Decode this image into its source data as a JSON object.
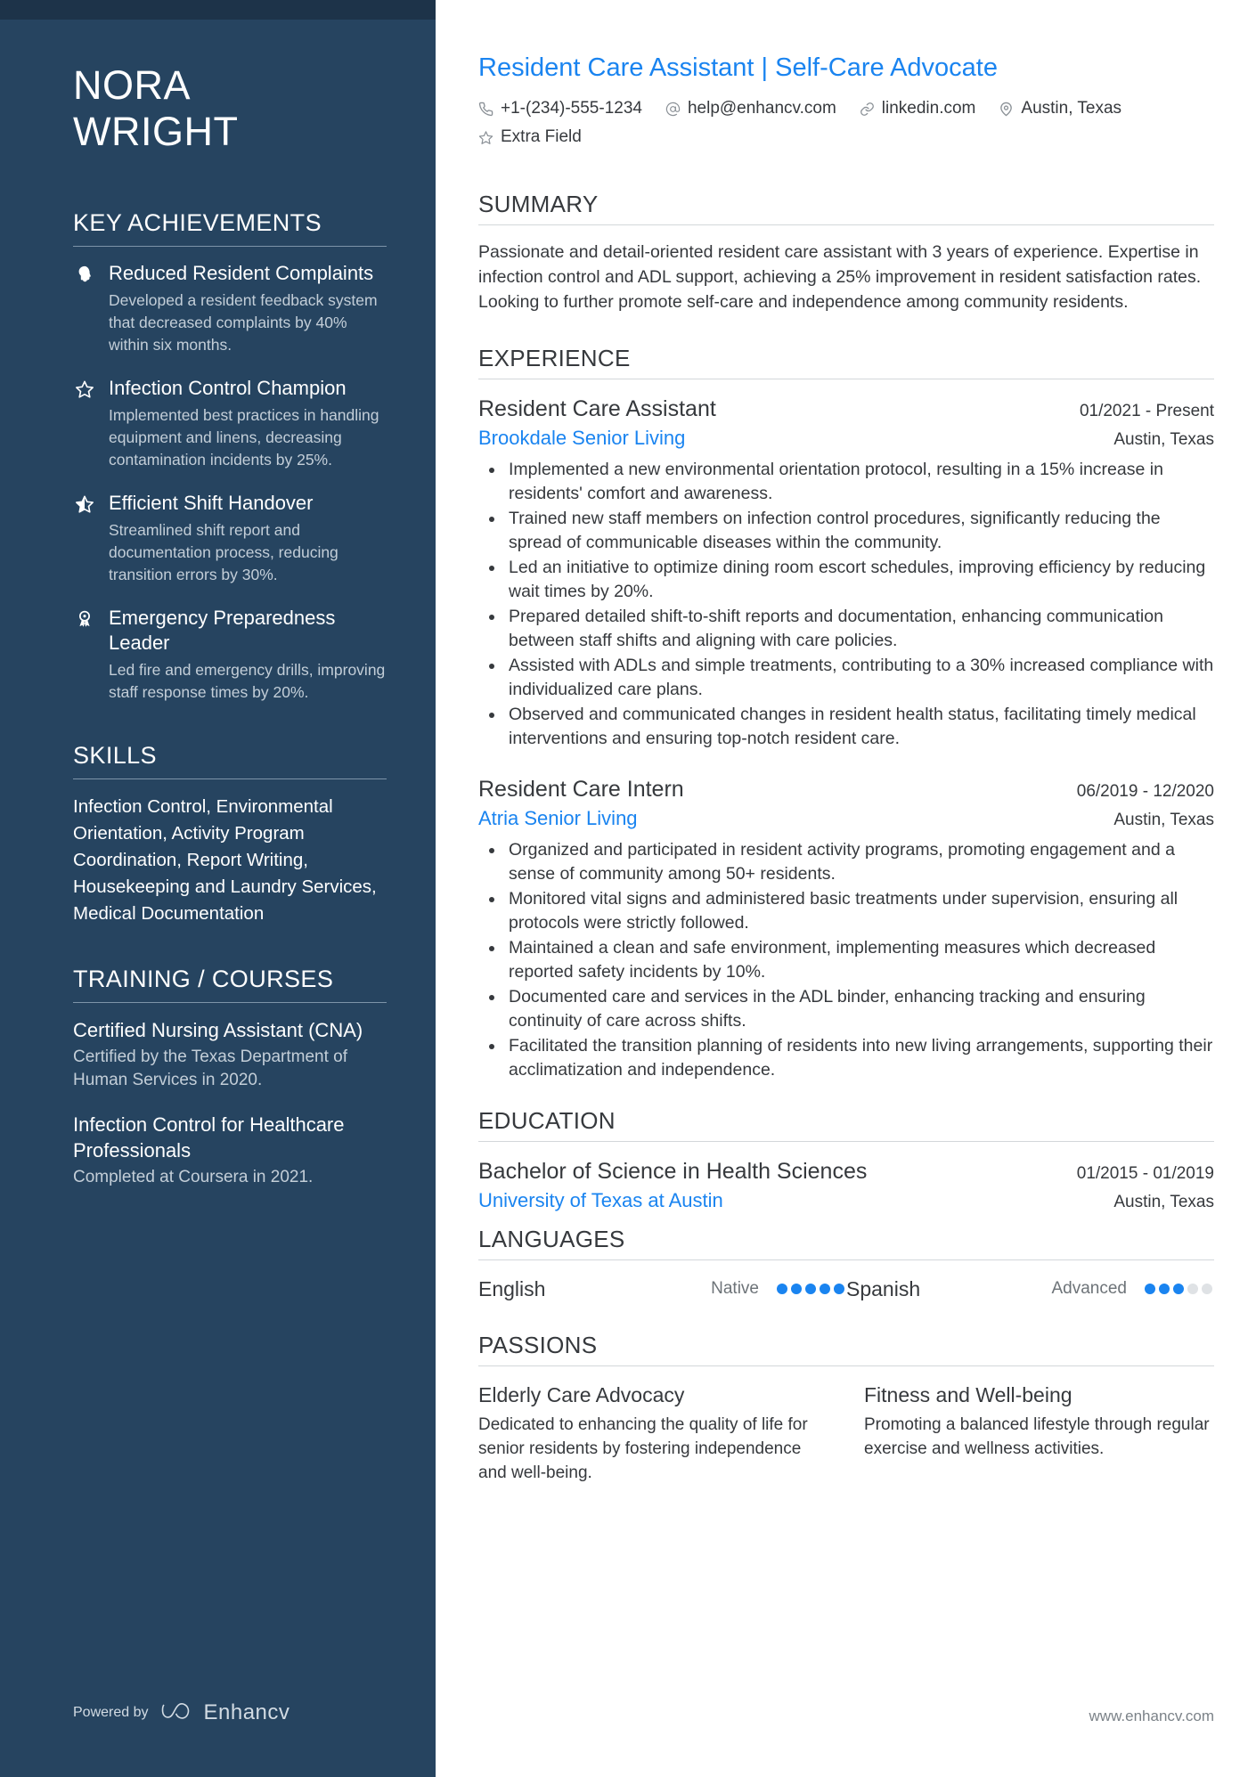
{
  "sidebar": {
    "name": {
      "first": "NORA",
      "last": "WRIGHT"
    },
    "key_achievements": {
      "heading": "KEY ACHIEVEMENTS",
      "items": [
        {
          "icon": "head-profile-icon",
          "title": "Reduced Resident Complaints",
          "desc": "Developed a resident feedback system that decreased complaints by 40% within six months."
        },
        {
          "icon": "star-outline-icon",
          "title": "Infection Control Champion",
          "desc": "Implemented best practices in handling equipment and linens, decreasing contamination incidents by 25%."
        },
        {
          "icon": "star-half-icon",
          "title": "Efficient Shift Handover",
          "desc": "Streamlined shift report and documentation process, reducing transition errors by 30%."
        },
        {
          "icon": "award-ribbon-icon",
          "title": "Emergency Preparedness Leader",
          "desc": "Led fire and emergency drills, improving staff response times by 20%."
        }
      ]
    },
    "skills": {
      "heading": "SKILLS",
      "text": "Infection Control, Environmental Orientation, Activity Program Coordination, Report Writing, Housekeeping and Laundry Services, Medical Documentation"
    },
    "training": {
      "heading": "TRAINING / COURSES",
      "items": [
        {
          "title": "Certified Nursing Assistant (CNA)",
          "desc": "Certified by the Texas Department of Human Services in 2020."
        },
        {
          "title": "Infection Control for Healthcare Professionals",
          "desc": "Completed at Coursera in 2021."
        }
      ]
    },
    "footer": {
      "powered_by": "Powered by",
      "brand": "Enhancv"
    }
  },
  "main": {
    "job_title": "Resident Care Assistant | Self-Care Advocate",
    "contacts": [
      {
        "icon": "phone-icon",
        "text": "+1-(234)-555-1234"
      },
      {
        "icon": "at-sign-icon",
        "text": "help@enhancv.com"
      },
      {
        "icon": "link-icon",
        "text": "linkedin.com"
      },
      {
        "icon": "location-pin-icon",
        "text": "Austin, Texas"
      }
    ],
    "contacts_row2": [
      {
        "icon": "star-outline-icon",
        "text": "Extra Field"
      }
    ],
    "summary": {
      "heading": "SUMMARY",
      "text": "Passionate and detail-oriented resident care assistant with 3 years of experience. Expertise in infection control and ADL support, achieving a 25% improvement in resident satisfaction rates. Looking to further promote self-care and independence among community residents."
    },
    "experience": {
      "heading": "EXPERIENCE",
      "entries": [
        {
          "role": "Resident Care Assistant",
          "dates": "01/2021 - Present",
          "company": "Brookdale Senior Living",
          "location": "Austin, Texas",
          "bullets": [
            "Implemented a new environmental orientation protocol, resulting in a 15% increase in residents' comfort and awareness.",
            "Trained new staff members on infection control procedures, significantly reducing the spread of communicable diseases within the community.",
            "Led an initiative to optimize dining room escort schedules, improving efficiency by reducing wait times by 20%.",
            "Prepared detailed shift-to-shift reports and documentation, enhancing communication between staff shifts and aligning with care policies.",
            "Assisted with ADLs and simple treatments, contributing to a 30% increased compliance with individualized care plans.",
            "Observed and communicated changes in resident health status, facilitating timely medical interventions and ensuring top-notch resident care."
          ]
        },
        {
          "role": "Resident Care Intern",
          "dates": "06/2019 - 12/2020",
          "company": "Atria Senior Living",
          "location": "Austin, Texas",
          "bullets": [
            "Organized and participated in resident activity programs, promoting engagement and a sense of community among 50+ residents.",
            "Monitored vital signs and administered basic treatments under supervision, ensuring all protocols were strictly followed.",
            "Maintained a clean and safe environment, implementing measures which decreased reported safety incidents by 10%.",
            "Documented care and services in the ADL binder, enhancing tracking and ensuring continuity of care across shifts.",
            "Facilitated the transition planning of residents into new living arrangements, supporting their acclimatization and independence."
          ]
        }
      ]
    },
    "education": {
      "heading": "EDUCATION",
      "entries": [
        {
          "degree": "Bachelor of Science in Health Sciences",
          "dates": "01/2015 - 01/2019",
          "school": "University of Texas at Austin",
          "location": "Austin, Texas"
        }
      ]
    },
    "languages": {
      "heading": "LANGUAGES",
      "items": [
        {
          "name": "English",
          "level": "Native",
          "filled": 5,
          "total": 5
        },
        {
          "name": "Spanish",
          "level": "Advanced",
          "filled": 3,
          "total": 5
        }
      ]
    },
    "passions": {
      "heading": "PASSIONS",
      "items": [
        {
          "title": "Elderly Care Advocacy",
          "desc": "Dedicated to enhancing the quality of life for senior residents by fostering independence and well-being."
        },
        {
          "title": "Fitness and Well-being",
          "desc": "Promoting a balanced lifestyle through regular exercise and wellness activities."
        }
      ]
    },
    "footer_url": "www.enhancv.com"
  },
  "colors": {
    "sidebar_bg": "#264460",
    "sidebar_top": "#1d3349",
    "accent_blue": "#1a84f0",
    "body_text": "#36393d",
    "muted_text": "#c3ced8"
  }
}
